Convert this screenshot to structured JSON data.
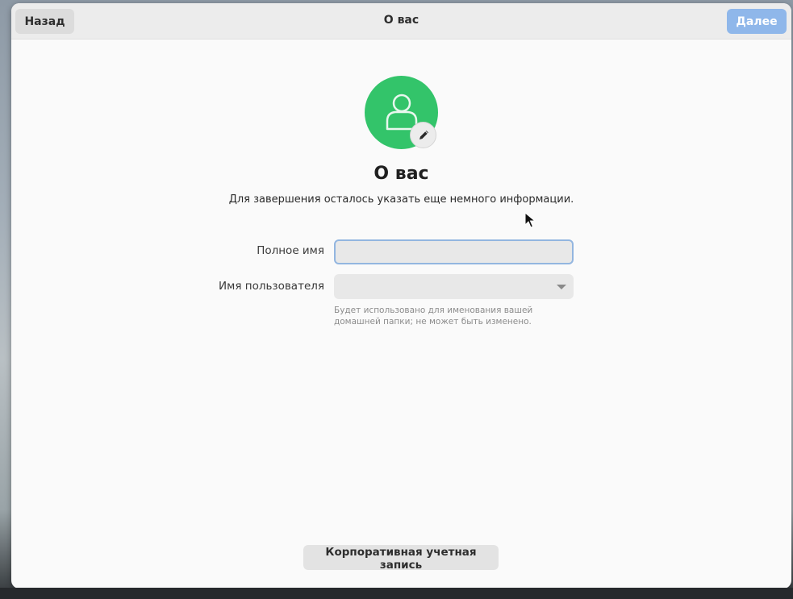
{
  "header": {
    "title": "О вас",
    "back_label": "Назад",
    "next_label": "Далее"
  },
  "main": {
    "title": "О вас",
    "subtitle": "Для завершения осталось указать еще немного информации.",
    "avatar_icon": "user-avatar-icon",
    "avatar_color": "#33c46a",
    "edit_icon": "pencil-icon"
  },
  "form": {
    "fullname_label": "Полное имя",
    "fullname_value": "",
    "username_label": "Имя пользователя",
    "username_value": "",
    "username_hint": "Будет использовано для именования вашей домашней папки; не может быть изменено."
  },
  "footer": {
    "enterprise_label": "Корпоративная учетная запись"
  },
  "colors": {
    "accent": "#8fb7ea",
    "focus_border": "#93b6e0"
  }
}
